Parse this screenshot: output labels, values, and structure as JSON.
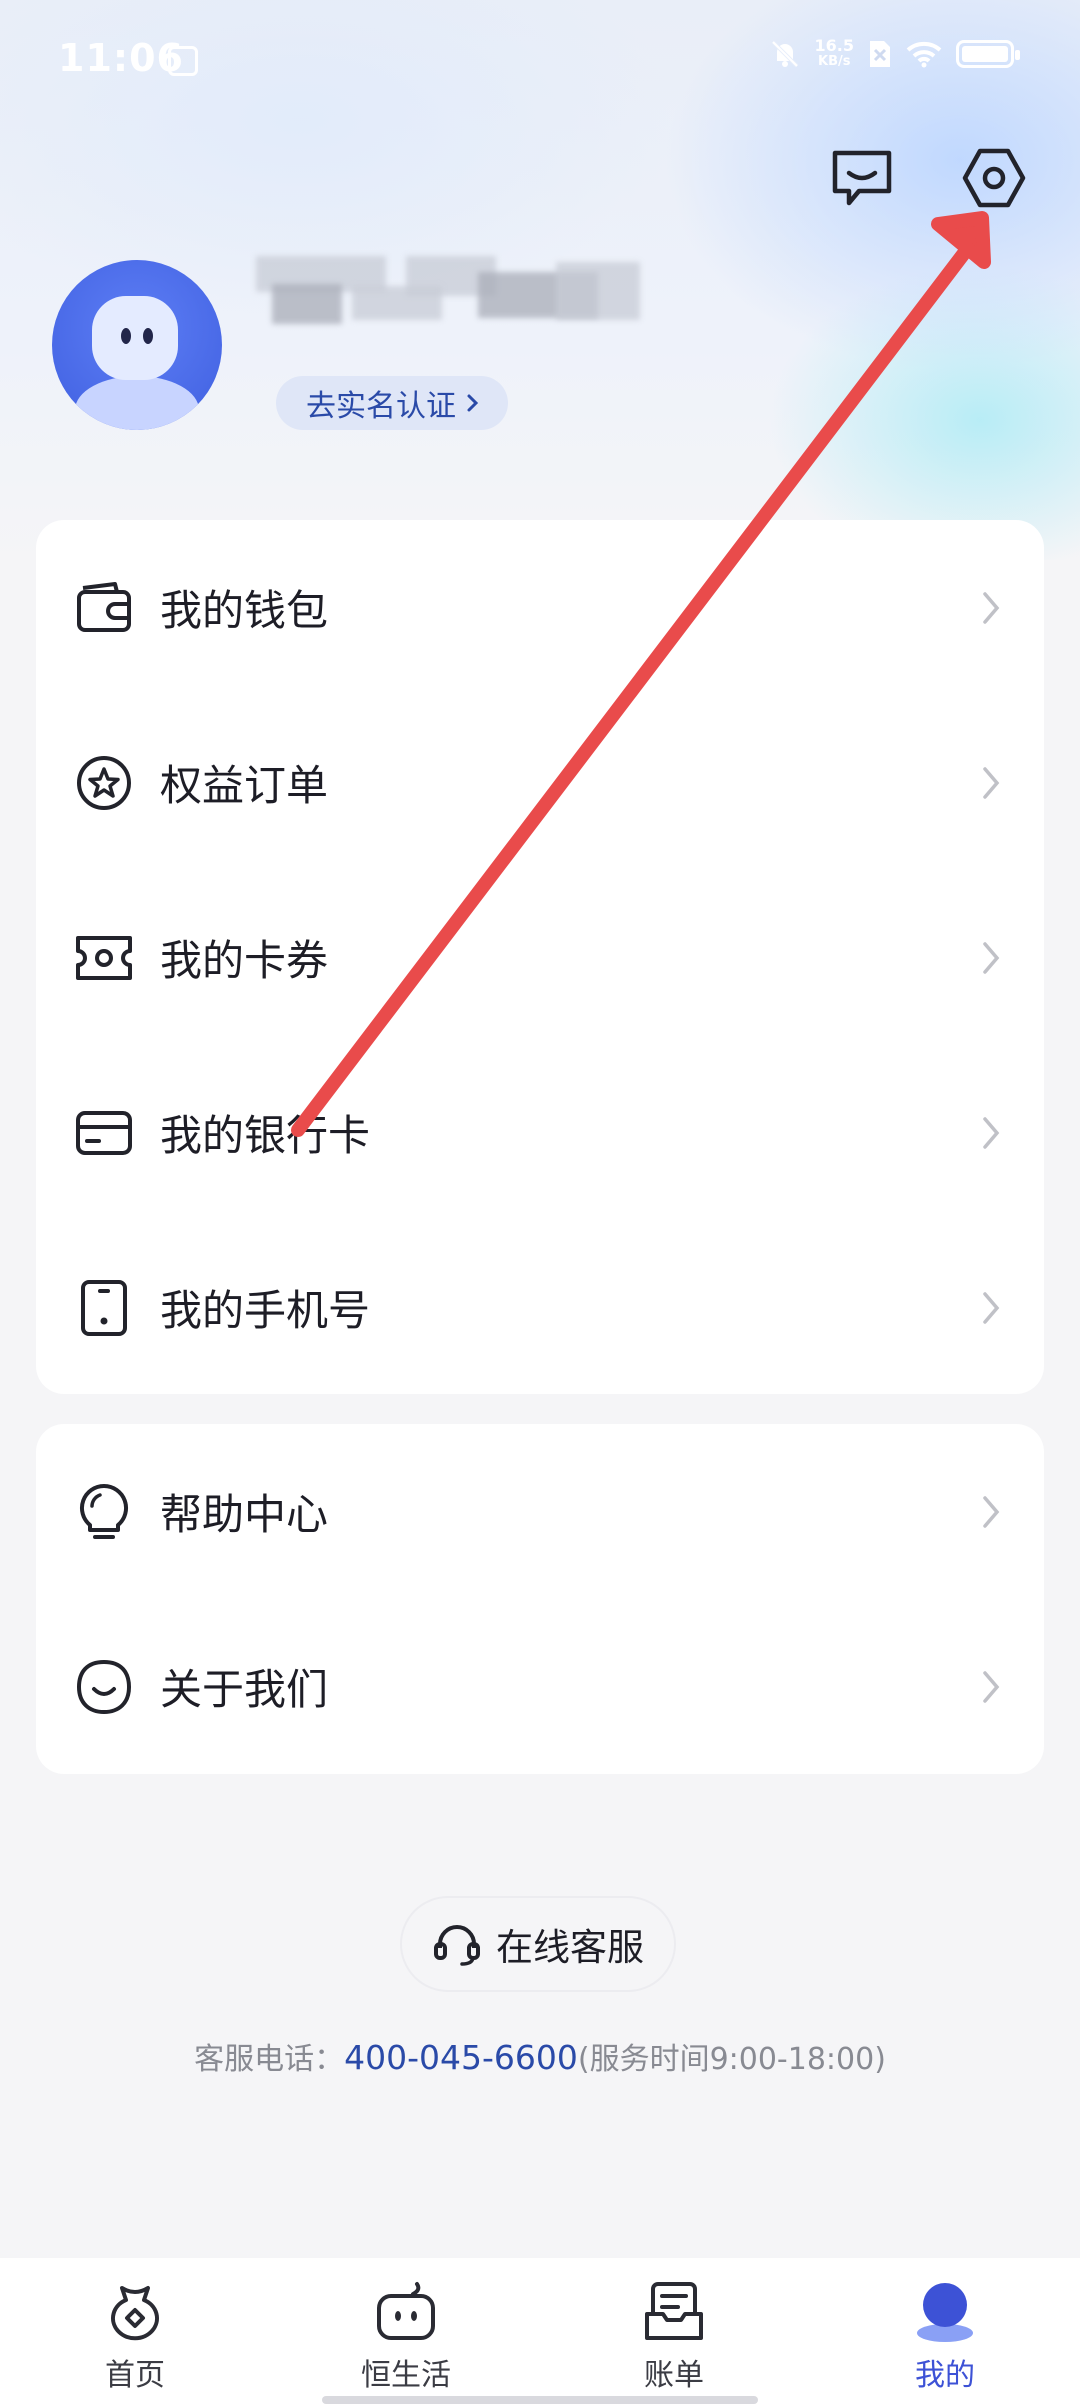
{
  "status_bar": {
    "time": "11:06",
    "net_speed_value": "16.5",
    "net_speed_unit": "KB/s"
  },
  "profile": {
    "verify_label": "去实名认证"
  },
  "menu_group_1": [
    {
      "label": "我的钱包",
      "icon": "wallet-icon"
    },
    {
      "label": "权益订单",
      "icon": "star-badge-icon"
    },
    {
      "label": "我的卡券",
      "icon": "coupon-icon"
    },
    {
      "label": "我的银行卡",
      "icon": "bank-card-icon"
    },
    {
      "label": "我的手机号",
      "icon": "phone-icon"
    }
  ],
  "menu_group_2": [
    {
      "label": "帮助中心",
      "icon": "lightbulb-icon"
    },
    {
      "label": "关于我们",
      "icon": "smile-icon"
    }
  ],
  "support": {
    "button_label": "在线客服",
    "hotline_prefix": "客服电话：",
    "hotline_number": "400-045-6600",
    "hotline_hours": "(服务时间9:00-18:00)"
  },
  "tabbar": [
    {
      "label": "首页",
      "icon": "home-money-bag-icon"
    },
    {
      "label": "恒生活",
      "icon": "life-mascot-icon"
    },
    {
      "label": "账单",
      "icon": "bill-icon"
    },
    {
      "label": "我的",
      "icon": "profile-icon",
      "active": true
    }
  ],
  "colors": {
    "accent": "#3d52d6",
    "link": "#2a4aa8",
    "annotation_arrow": "#e94b4b"
  }
}
